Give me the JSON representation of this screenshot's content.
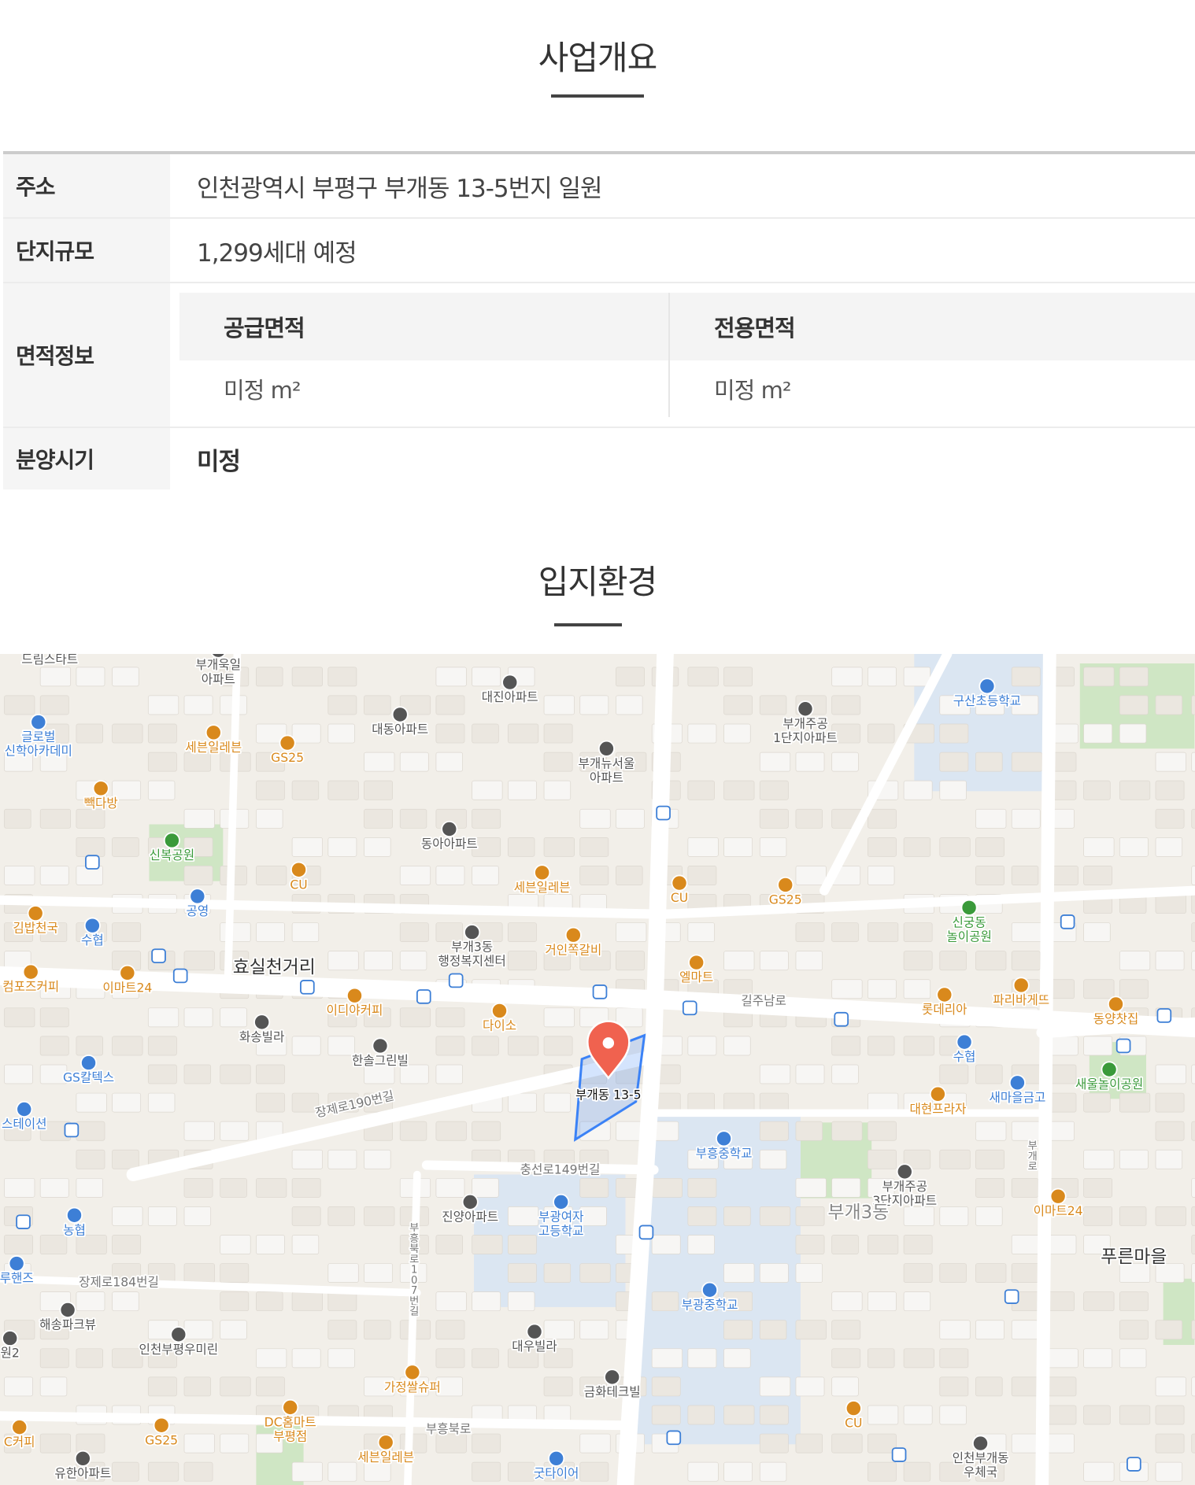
{
  "overview": {
    "title": "사업개요",
    "rows": {
      "address": {
        "label": "주소",
        "value": "인천광역시 부평구 부개동 13-5번지 일원"
      },
      "scale": {
        "label": "단지규모",
        "value": "1,299세대 예정"
      },
      "area": {
        "label": "면적정보",
        "supply_header": "공급면적",
        "exclusive_header": "전용면적",
        "supply_value": "미정 m²",
        "exclusive_value": "미정 m²"
      },
      "sale": {
        "label": "분양시기",
        "value": "미정"
      }
    }
  },
  "location": {
    "title": "입지환경",
    "map": {
      "marker_label": "부개동 13-5",
      "colors": {
        "marker": "#f0624f",
        "boundary": "#3b82f6",
        "school": "#3d7fd6",
        "shop": "#d9891c",
        "apt": "#555555",
        "park": "#3a9a3a"
      },
      "labels": [
        "드림스타트",
        "부개욱일\n아파트",
        "대진아파트",
        "대동아파트",
        "부개뉴서울\n아파트",
        "부개주공\n1단지아파트",
        "구산초등학교",
        "글로벌\n신학아카데미",
        "세븐일레븐",
        "GS25",
        "빽다방",
        "신복공원",
        "CU",
        "동아아파트",
        "세븐일레븐",
        "CU",
        "GS25",
        "신궁동\n놀이공원",
        "공영",
        "김밥천국",
        "수협",
        "부개3동\n행정복지센터",
        "거인쪽갈비",
        "엘마트",
        "효실천거리",
        "컴포즈커피",
        "이마트24",
        "이디야커피",
        "다이소",
        "길주남로",
        "롯데리아",
        "파리바게뜨",
        "동양찻집",
        "화송빌라",
        "한솔그린빌",
        "수협",
        "GS칼텍스",
        "새마을금고",
        "새울놀이공원",
        "스테이션",
        "장제로190번길",
        "대현프라자",
        "부흥중학교",
        "충선로149번길",
        "부개주공\n3단지아파트",
        "부개3동",
        "이마트24",
        "진양아파트",
        "부광여자\n고등학교",
        "농협",
        "푸른마을",
        "루핸즈",
        "장제로184번길",
        "부광중학교",
        "해송파크뷰",
        "인천부평우미린",
        "대우빌라",
        "원2",
        "가정쌀슈퍼",
        "금화테크빌",
        "DC홈마트\n부평점",
        "GS25",
        "C커피",
        "세븐일레븐",
        "부흥북로",
        "굿타이어",
        "유한아파트",
        "CU",
        "인천부개동\n우체국",
        "부\n흥\n북\n로\n1\n0\n7\n번\n길",
        "부\n개\n로"
      ]
    }
  }
}
